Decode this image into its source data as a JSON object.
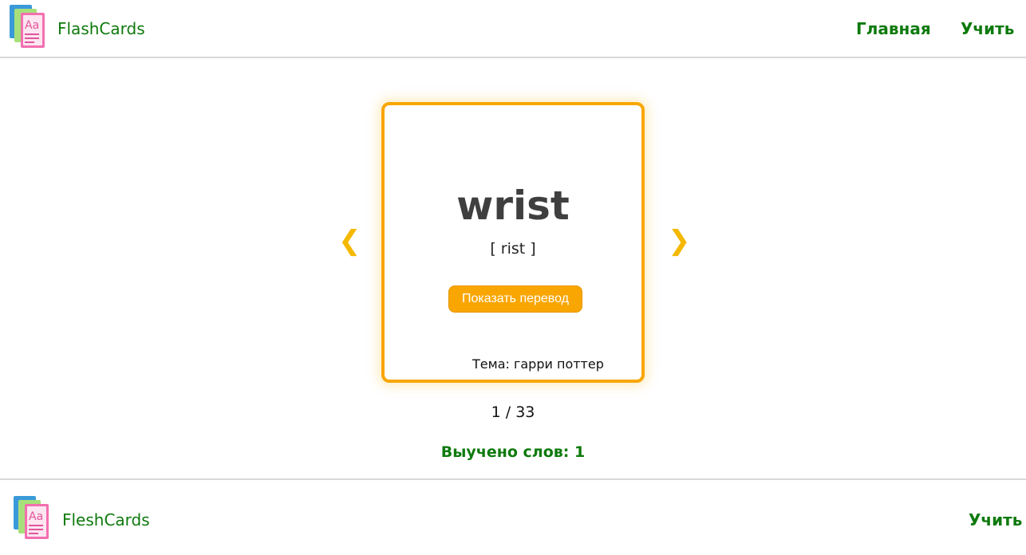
{
  "header": {
    "brand": "FlashCards",
    "nav": [
      {
        "label": "Главная"
      },
      {
        "label": "Учить"
      }
    ]
  },
  "card": {
    "word": "wrist",
    "transcription": "[ rist ]",
    "show_button": "Показать перевод",
    "topic": "Тема: гарри поттер"
  },
  "navigation": {
    "prev_icon": "chevron-left-icon",
    "next_icon": "chevron-right-icon",
    "prev_glyph": "❮",
    "next_glyph": "❯"
  },
  "progress": {
    "counter": "1 / 33",
    "current": 1,
    "total": 33,
    "learned": "Выучено слов: 1"
  },
  "footer": {
    "brand": "FleshCards",
    "nav": [
      {
        "label": "Учить"
      }
    ]
  },
  "colors": {
    "brand_green": "#0e7a0d",
    "accent_orange": "#f9a602",
    "arrow_yellow": "#f5b800"
  }
}
